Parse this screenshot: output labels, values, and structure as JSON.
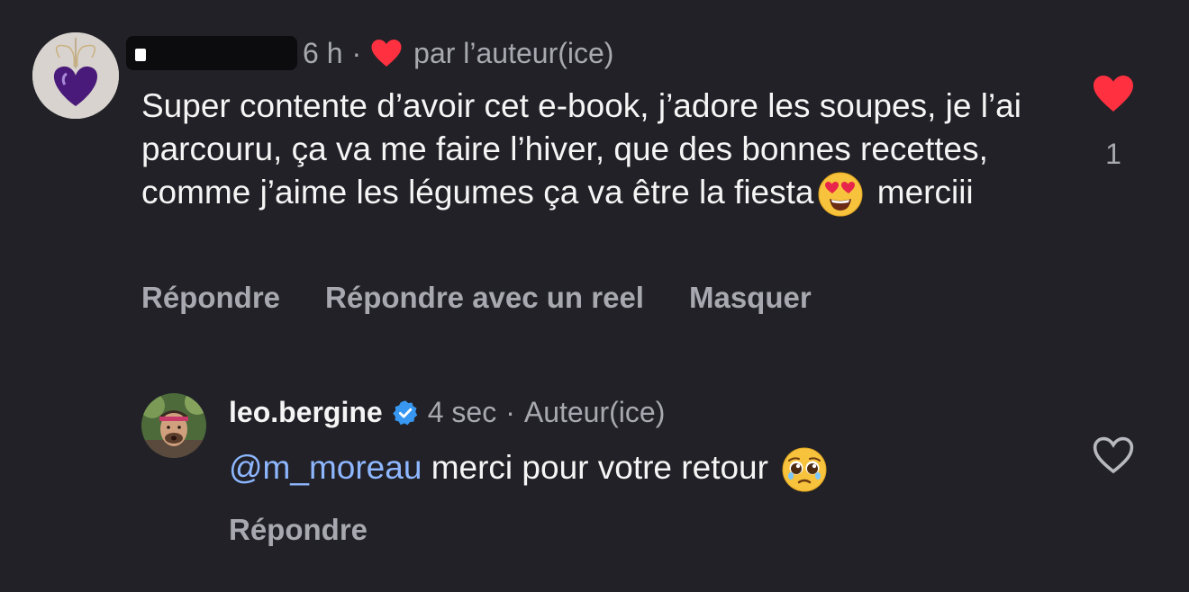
{
  "comment": {
    "time": "6 h",
    "liked_by_author_label": "par l’auteur(ice)",
    "text_before_emoji": "Super contente d’avoir cet e-book, j’adore les soupes, je l’ai parcouru, ça va me faire l’hiver, que des bonnes recettes, comme j’aime les légumes ça va être la fiesta",
    "text_after_emoji": "merciii",
    "emoji": "heart-eyes",
    "actions": [
      "Répondre",
      "Répondre avec un reel",
      "Masquer"
    ],
    "like_count": "1",
    "liked": true
  },
  "reply": {
    "username": "leo.bergine",
    "verified": true,
    "time": "4 sec",
    "role_label": "Auteur(ice)",
    "mention": "@m_moreau",
    "text": "merci pour votre retour",
    "emoji": "pleading-face",
    "action_reply": "Répondre",
    "liked": false
  },
  "colors": {
    "background": "#212127",
    "text": "#f5f5f5",
    "muted": "#a8a8b0",
    "like_red": "#ff3040",
    "mention": "#8eb7ff",
    "verified_blue": "#3897f0"
  }
}
